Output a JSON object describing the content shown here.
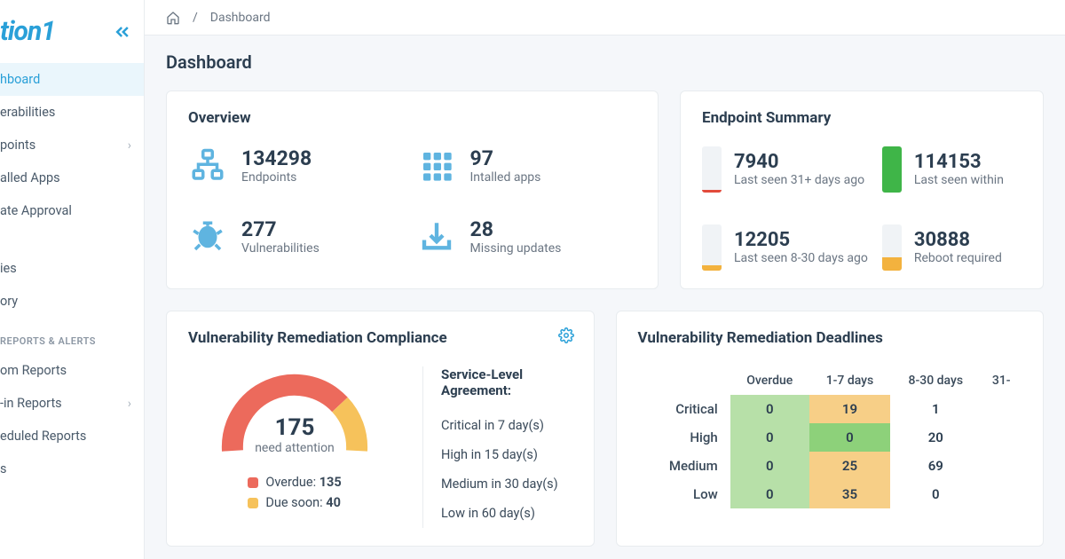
{
  "logo_text": "tion1",
  "breadcrumb": {
    "current": "Dashboard"
  },
  "page_title": "Dashboard",
  "sidebar": {
    "items": [
      {
        "label": "hboard",
        "active": true
      },
      {
        "label": "erabilities"
      },
      {
        "label": "points",
        "expandable": true
      },
      {
        "label": "alled Apps"
      },
      {
        "label": "ate Approval"
      }
    ],
    "items2": [
      {
        "label": "ies"
      },
      {
        "label": "ory"
      }
    ],
    "section_label": "REPORTS & ALERTS",
    "items3": [
      {
        "label": "om Reports"
      },
      {
        "label": "-in Reports",
        "expandable": true
      },
      {
        "label": "eduled Reports"
      },
      {
        "label": "s"
      }
    ]
  },
  "overview": {
    "title": "Overview",
    "stats": [
      {
        "value": "134298",
        "label": "Endpoints"
      },
      {
        "value": "97",
        "label": "Intalled apps"
      },
      {
        "value": "277",
        "label": "Vulnerabilities"
      },
      {
        "value": "28",
        "label": "Missing updates"
      }
    ]
  },
  "endpoint_summary": {
    "title": "Endpoint Summary",
    "items": [
      {
        "value": "7940",
        "label": "Last seen 31+ days ago",
        "fill_pct": 6,
        "color": "#e24a3b"
      },
      {
        "value": "114153",
        "label": "Last seen within",
        "fill_pct": 100,
        "color": "#3fb548"
      },
      {
        "value": "12205",
        "label": "Last seen 8-30 days ago",
        "fill_pct": 12,
        "color": "#f3b23e"
      },
      {
        "value": "30888",
        "label": "Reboot required",
        "fill_pct": 28,
        "color": "#f3b23e"
      }
    ]
  },
  "compliance": {
    "title": "Vulnerability Remediation Compliance",
    "gauge_value": "175",
    "gauge_label": "need attention",
    "legend": [
      {
        "color": "#ec6a5c",
        "text_pre": "Overdue: ",
        "text_val": "135"
      },
      {
        "color": "#f6c25b",
        "text_pre": "Due soon: ",
        "text_val": "40"
      }
    ],
    "sla_title": "Service-Level Agreement:",
    "sla": [
      "Critical in 7 day(s)",
      "High in 15 day(s)",
      "Medium in 30 day(s)",
      "Low in 60 day(s)"
    ]
  },
  "deadlines": {
    "title": "Vulnerability Remediation Deadlines",
    "cols": [
      "Overdue",
      "1-7 days",
      "8-30 days",
      "31-"
    ],
    "rows": [
      {
        "label": "Critical",
        "cells": [
          {
            "v": "0",
            "c": "cell-g"
          },
          {
            "v": "19",
            "c": "cell-o"
          },
          {
            "v": "1",
            "c": "cell-w"
          },
          {
            "v": "",
            "c": "cell-w"
          }
        ]
      },
      {
        "label": "High",
        "cells": [
          {
            "v": "0",
            "c": "cell-g"
          },
          {
            "v": "0",
            "c": "cell-dg"
          },
          {
            "v": "20",
            "c": "cell-w"
          },
          {
            "v": "",
            "c": "cell-w"
          }
        ]
      },
      {
        "label": "Medium",
        "cells": [
          {
            "v": "0",
            "c": "cell-g"
          },
          {
            "v": "25",
            "c": "cell-o"
          },
          {
            "v": "69",
            "c": "cell-w"
          },
          {
            "v": "",
            "c": "cell-w"
          }
        ]
      },
      {
        "label": "Low",
        "cells": [
          {
            "v": "0",
            "c": "cell-g"
          },
          {
            "v": "35",
            "c": "cell-o"
          },
          {
            "v": "0",
            "c": "cell-w"
          },
          {
            "v": "",
            "c": "cell-w"
          }
        ]
      }
    ]
  }
}
